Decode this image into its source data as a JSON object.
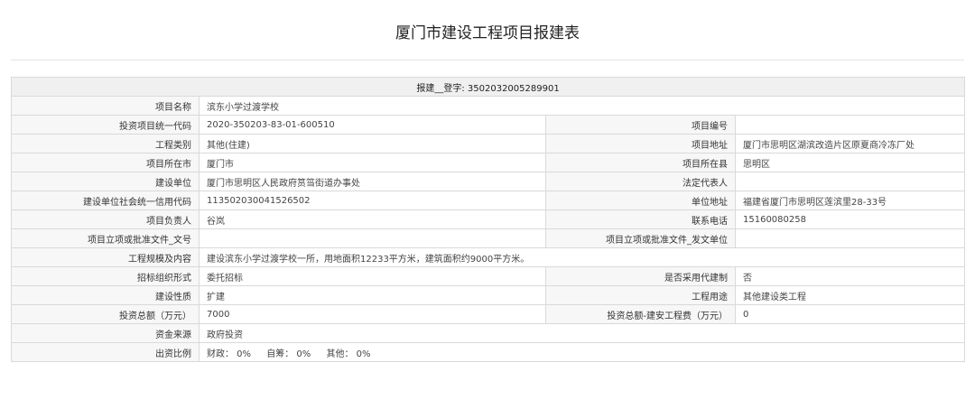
{
  "page_title": "厦门市建设工程项目报建表",
  "table_header": "报建__登字: 3502032005289901",
  "rows": [
    {
      "l1": "项目名称",
      "v1": "滨东小学过渡学校"
    },
    {
      "l1": "投资项目统一代码",
      "v1": "2020-350203-83-01-600510",
      "l2": "项目编号",
      "v2": ""
    },
    {
      "l1": "工程类别",
      "v1": "其他(住建)",
      "l2": "项目地址",
      "v2": "厦门市思明区湖滨改造片区原夏商冷冻厂处"
    },
    {
      "l1": "项目所在市",
      "v1": "厦门市",
      "l2": "项目所在县",
      "v2": "思明区"
    },
    {
      "l1": "建设单位",
      "v1": "厦门市思明区人民政府筼筜街道办事处",
      "l2": "法定代表人",
      "v2": ""
    },
    {
      "l1": "建设单位社会统一信用代码",
      "v1": "113502030041526502",
      "l2": "单位地址",
      "v2": "福建省厦门市思明区莲滨里28-33号"
    },
    {
      "l1": "项目负责人",
      "v1": "谷岚",
      "l2": "联系电话",
      "v2": "15160080258"
    },
    {
      "l1": "项目立项或批准文件_文号",
      "v1": "",
      "l2": "项目立项或批准文件_发文单位",
      "v2": ""
    },
    {
      "l1": "工程规模及内容",
      "v1": "建设滨东小学过渡学校一所，用地面积12233平方米，建筑面积约9000平方米。"
    },
    {
      "l1": "招标组织形式",
      "v1": "委托招标",
      "l2": "是否采用代建制",
      "v2": "否"
    },
    {
      "l1": "建设性质",
      "v1": "扩建",
      "l2": "工程用途",
      "v2": "其他建设类工程"
    },
    {
      "l1": "投资总额（万元）",
      "v1": "7000",
      "l2": "投资总额-建安工程费（万元）",
      "v2": "0"
    },
    {
      "l1": "资金来源",
      "v1": "政府投资"
    }
  ],
  "ratio_row": {
    "label": "出资比例",
    "items": [
      "财政： 0%",
      "自筹： 0%",
      "其他： 0%"
    ]
  }
}
